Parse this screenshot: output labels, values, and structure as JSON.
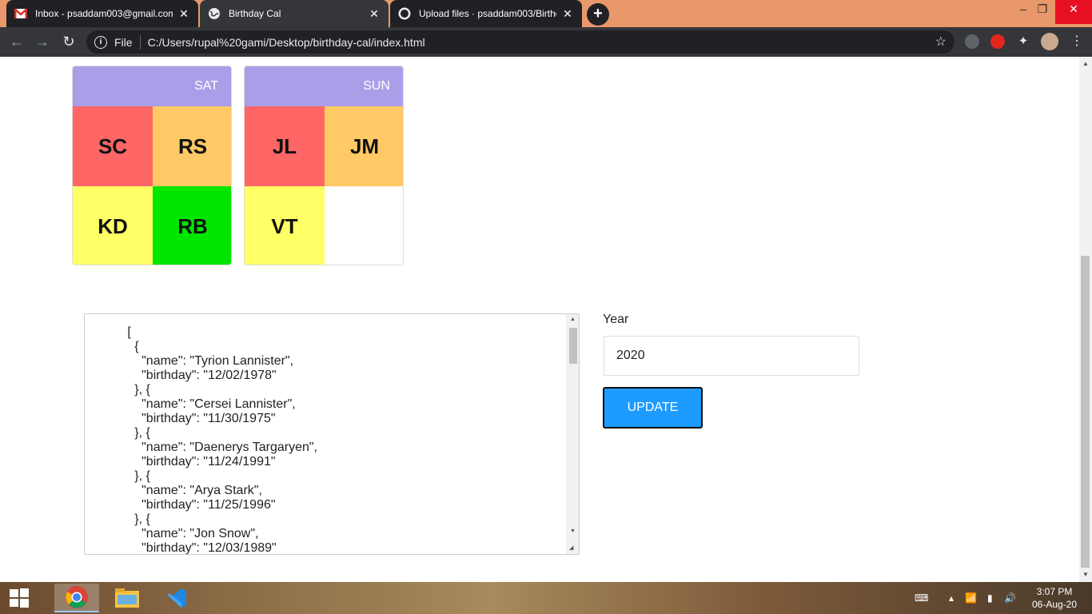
{
  "browser": {
    "tabs": [
      {
        "title": "Inbox - psaddam003@gmail.com",
        "icon": "gmail-icon"
      },
      {
        "title": "Birthday Cal",
        "icon": "globe-icon"
      },
      {
        "title": "Upload files · psaddam003/Birthday-Cal",
        "icon": "github-icon"
      }
    ],
    "scheme": "File",
    "url": "C:/Users/rupal%20gami/Desktop/birthday-cal/index.html"
  },
  "calendar": {
    "days": [
      {
        "label": "SAT",
        "cells": [
          {
            "initials": "SC",
            "color": "#ff6666"
          },
          {
            "initials": "RS",
            "color": "#ffc966"
          },
          {
            "initials": "KD",
            "color": "#ffff66"
          },
          {
            "initials": "RB",
            "color": "#00e600"
          }
        ]
      },
      {
        "label": "SUN",
        "cells": [
          {
            "initials": "JL",
            "color": "#ff6666"
          },
          {
            "initials": "JM",
            "color": "#ffc966"
          },
          {
            "initials": "VT",
            "color": "#ffff66"
          },
          {
            "initials": "",
            "color": "#ffffff"
          }
        ]
      }
    ]
  },
  "editor": {
    "json_text": "            [\n              {\n                \"name\": \"Tyrion Lannister\",\n                \"birthday\": \"12/02/1978\"\n              }, {\n                \"name\": \"Cersei Lannister\",\n                \"birthday\": \"11/30/1975\"\n              }, {\n                \"name\": \"Daenerys Targaryen\",\n                \"birthday\": \"11/24/1991\"\n              }, {\n                \"name\": \"Arya Stark\",\n                \"birthday\": \"11/25/1996\"\n              }, {\n                \"name\": \"Jon Snow\",\n                \"birthday\": \"12/03/1989\""
  },
  "form": {
    "year_label": "Year",
    "year_value": "2020",
    "update_label": "UPDATE"
  },
  "taskbar": {
    "time": "3:07 PM",
    "date": "06-Aug-20"
  }
}
